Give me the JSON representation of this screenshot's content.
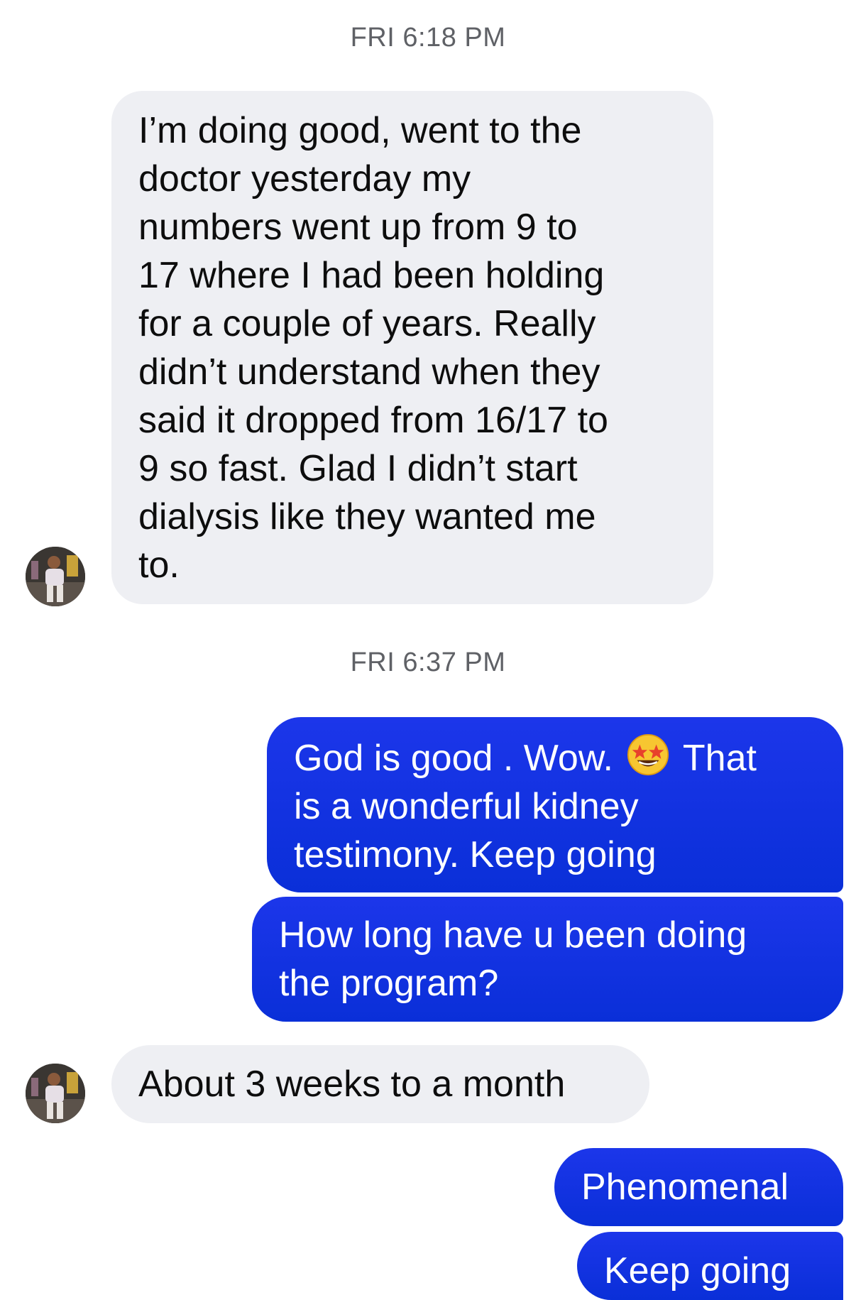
{
  "conversation": {
    "timestamps": [
      {
        "label": "FRI 6:18 PM"
      },
      {
        "label": "FRI 6:37 PM"
      }
    ],
    "messages": [
      {
        "sender": "contact",
        "text": "I’m doing good, went to the\ndoctor yesterday my\nnumbers went up from 9 to\n17 where I had been holding\nfor a couple of years. Really\ndidn’t understand when they\nsaid it dropped from 16/17 to\n9 so fast. Glad I didn’t start\ndialysis like they wanted me\nto."
      },
      {
        "sender": "me",
        "text_part1": "God is good . Wow.",
        "emoji": "star-struck-emoji",
        "text_part2": "That",
        "text_rest": "is a wonderful kidney\ntestimony. Keep going"
      },
      {
        "sender": "me",
        "text": "How long have u been doing\nthe program?"
      },
      {
        "sender": "contact",
        "text": "About 3 weeks to a month"
      },
      {
        "sender": "me",
        "text": "Phenomenal"
      },
      {
        "sender": "me",
        "text": "Keep going"
      }
    ],
    "colors": {
      "incoming_bubble": "#eeeff3",
      "outgoing_bubble": "#0a2fd8",
      "timestamp_text": "#5f6166"
    }
  }
}
